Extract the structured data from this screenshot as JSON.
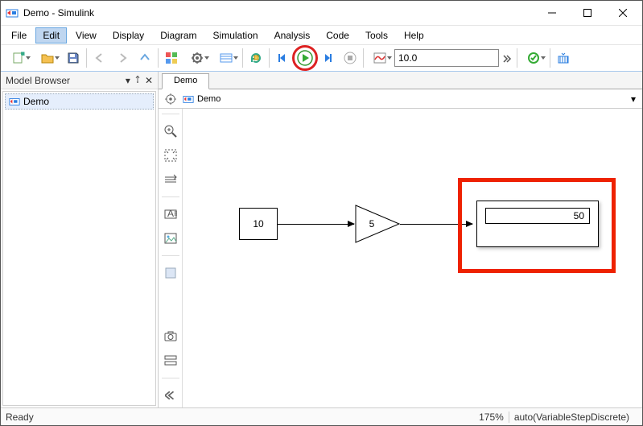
{
  "window": {
    "title": "Demo - Simulink"
  },
  "menu": {
    "file": "File",
    "edit": "Edit",
    "view": "View",
    "display": "Display",
    "diagram": "Diagram",
    "simulation": "Simulation",
    "analysis": "Analysis",
    "code": "Code",
    "tools": "Tools",
    "help": "Help"
  },
  "toolbar": {
    "stop_time": "10.0"
  },
  "browser": {
    "title": "Model Browser",
    "root": "Demo"
  },
  "tabs": {
    "active": "Demo"
  },
  "breadcrumb": {
    "model": "Demo"
  },
  "blocks": {
    "constant": {
      "value": "10"
    },
    "gain": {
      "value": "5"
    },
    "display": {
      "value": "50"
    }
  },
  "status": {
    "ready": "Ready",
    "zoom": "175%",
    "solver": "auto(VariableStepDiscrete)"
  },
  "chart_data": {
    "type": "diagram",
    "description": "Simulink block diagram: Constant -> Gain -> Display",
    "blocks": [
      {
        "name": "Constant",
        "value": 10
      },
      {
        "name": "Gain",
        "value": 5
      },
      {
        "name": "Display",
        "value": 50
      }
    ],
    "connections": [
      [
        "Constant",
        "Gain"
      ],
      [
        "Gain",
        "Display"
      ]
    ]
  }
}
